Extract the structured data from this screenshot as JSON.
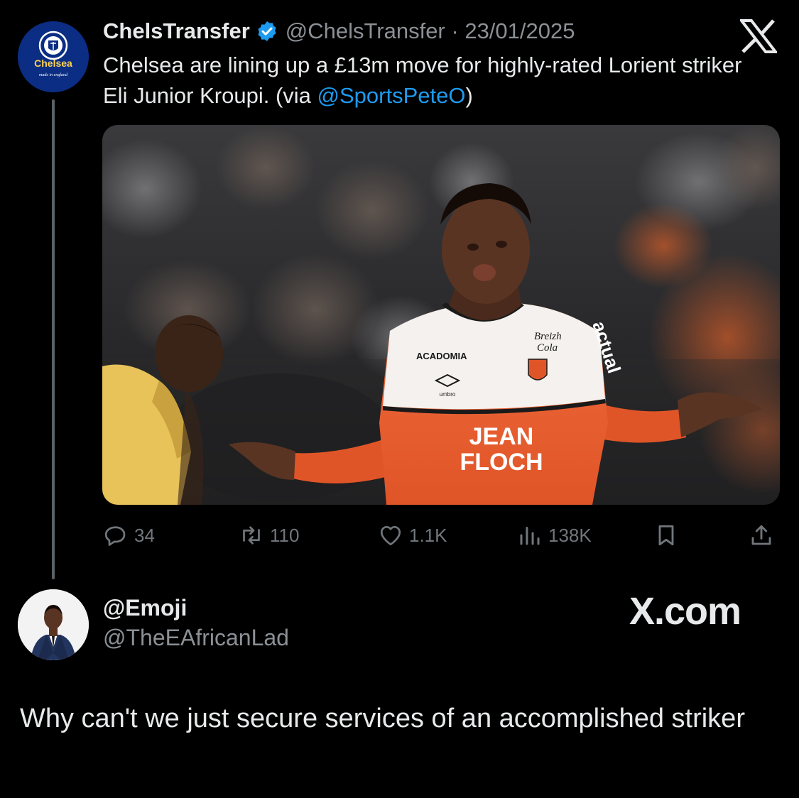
{
  "original_tweet": {
    "author": {
      "display_name": "ChelsTransfer",
      "handle": "@ChelsTransfer",
      "avatar_crest_text": "Chelsea",
      "avatar_tagline": "made in england"
    },
    "separator": " · ",
    "date": "23/01/2025",
    "text_before_mention": "Chelsea are lining up a £13m move for highly-rated Lorient striker Eli Junior Kroupi. (via ",
    "mention": "@SportsPeteO",
    "text_after_mention": ")",
    "media": {
      "jersey_sponsor": "JEAN FLOCH",
      "jersey_sponsor_line1": "JEAN",
      "jersey_sponsor_line2": "FLOCH",
      "chest_logo": "ACADOMIA",
      "kit_maker": "umbro",
      "sleeve_sponsor": "actual",
      "drink_logo_line1": "Breizh",
      "drink_logo_line2": "Cola"
    },
    "actions": {
      "replies": "34",
      "retweets": "110",
      "likes": "1.1K",
      "views": "138K"
    }
  },
  "reply": {
    "display_name": "@Emoji",
    "handle": "@TheEAfricanLad",
    "text": "Why can't we just secure services of an accomplished striker"
  },
  "brand_watermark": "X.com",
  "icons": {
    "verified": "verified-badge-icon",
    "x_logo": "x-logo-icon",
    "reply": "reply-icon",
    "retweet": "retweet-icon",
    "like": "heart-icon",
    "views": "views-icon",
    "bookmark": "bookmark-icon",
    "share": "share-icon"
  },
  "colors": {
    "background": "#000000",
    "text": "#e7e9ea",
    "muted": "#71767b",
    "link": "#1d9bf0",
    "verified": "#1d9bf0",
    "chelsea_blue": "#0b2d83"
  }
}
